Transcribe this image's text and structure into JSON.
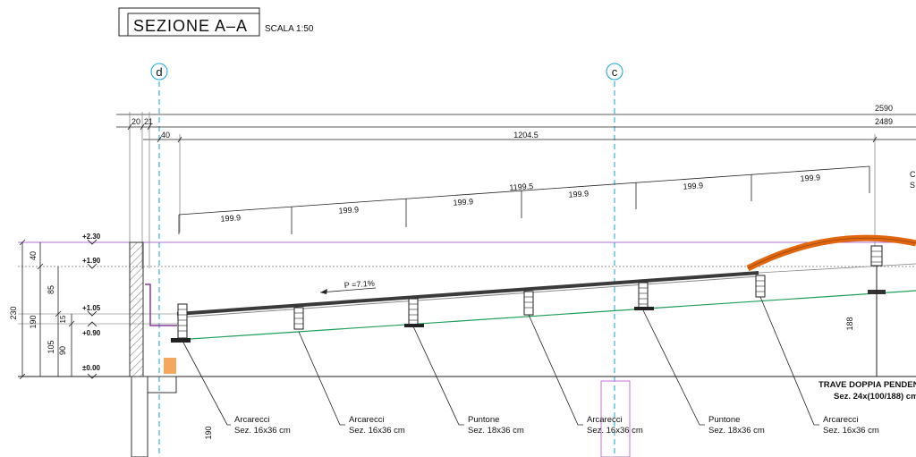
{
  "title": {
    "main": "SEZIONE A–A",
    "scale": "SCALA 1:50"
  },
  "gridlines": {
    "d": "d",
    "c": "c"
  },
  "dimensions": {
    "total": "2590",
    "span": "2489",
    "offset_a": "20",
    "offset_b": "21",
    "offset_c": "40",
    "first_span": "1204.5",
    "sloped_total": "1199.5",
    "bays": [
      "199.9",
      "199.9",
      "199.9",
      "199.9",
      "199.9",
      "199.9"
    ]
  },
  "levels": [
    "+2.30",
    "+1.90",
    "+1.05",
    "+0.90",
    "±0.00"
  ],
  "vertical_dims": {
    "d230": "230",
    "d40": "40",
    "d190": "190",
    "d85": "85",
    "d15": "15",
    "d105": "105",
    "d90": "90",
    "d190b": "190",
    "d188": "188"
  },
  "slope": "P =7.1%",
  "beam_label": {
    "line1": "TRAVE DOPPIA PENDEN",
    "line2": "Sez. 24x(100/188) cm"
  },
  "edge_labels": {
    "top": "C",
    "bottom": "S"
  },
  "callouts": [
    {
      "name": "Arcarecci",
      "section": "Sez. 16x36 cm"
    },
    {
      "name": "Arcarecci",
      "section": "Sez. 16x36 cm"
    },
    {
      "name": "Puntone",
      "section": "Sez. 18x36 cm"
    },
    {
      "name": "Arcarecci",
      "section": "Sez. 16x36 cm"
    },
    {
      "name": "Puntone",
      "section": "Sez. 18x36 cm"
    },
    {
      "name": "Arcarecci",
      "section": "Sez. 16x36 cm"
    }
  ],
  "colors": {
    "ink": "#111111",
    "guide": "#8a8a8a",
    "axis": "#1aa3d6",
    "roof": "#454545",
    "green": "#1f9d5a",
    "orange": "#e0660f",
    "purple": "#a855c8"
  }
}
